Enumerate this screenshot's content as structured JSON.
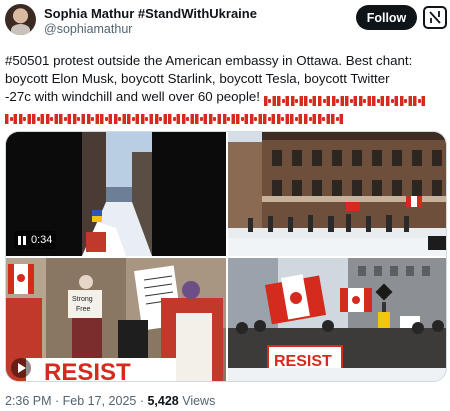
{
  "author": {
    "name": "Sophia Mathur #StandWithUkraine",
    "handle": "@sophiamathur",
    "follow_label": "Follow"
  },
  "tweet": {
    "line1": "#50501 protest outside the American embassy in Ottawa. Best chant:",
    "line2": "boycott Elon Musk, boycott Starlink, boycott Tesla, boycott Twitter",
    "line3": " -27c with windchill and well over 60 people!",
    "flag_count_line3": 12,
    "flag_count_line4": 25
  },
  "media": {
    "video_time": "0:34",
    "sign_left": "Strong Free",
    "sign_resist": "RESIST",
    "sign_banner_left": "RESIST"
  },
  "meta": {
    "time": "2:36 PM",
    "separator": " · ",
    "date": "Feb 17, 2025",
    "views_count": "5,428",
    "views_label": " Views"
  },
  "colors": {
    "flag_red": "#d52b1e",
    "muted": "#536471"
  },
  "icons": [
    "grok-icon",
    "pause-icon",
    "play-icon",
    "canada-flag-emoji"
  ]
}
